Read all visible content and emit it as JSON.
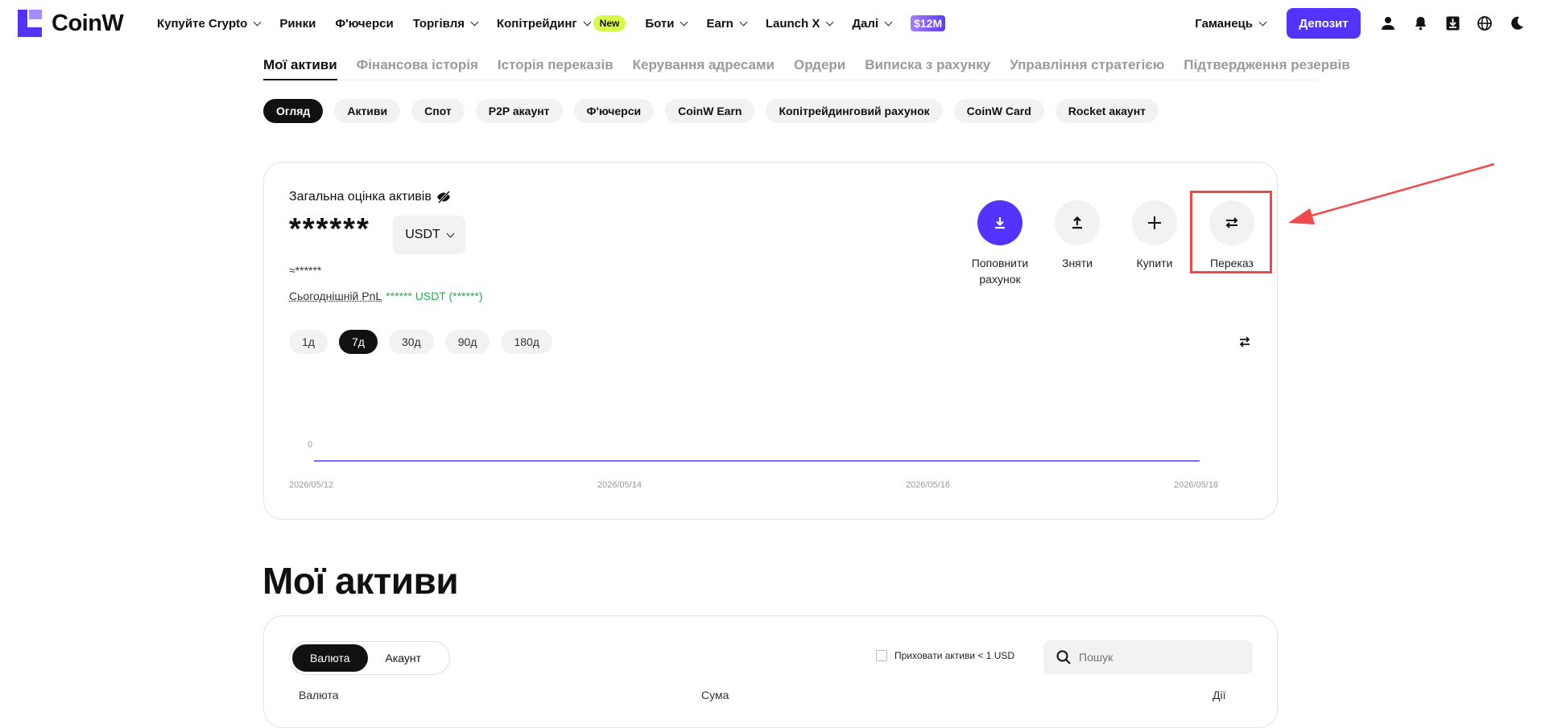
{
  "brand": {
    "name": "CoinW",
    "accent": "#5533ff"
  },
  "nav": {
    "items": [
      {
        "label": "Купуйте Crypto",
        "dropdown": true
      },
      {
        "label": "Ринки",
        "dropdown": false
      },
      {
        "label": "Ф'ючерси",
        "dropdown": false
      },
      {
        "label": "Торгівля",
        "dropdown": true
      },
      {
        "label": "Копітрейдинг",
        "dropdown": true,
        "badge": "New"
      },
      {
        "label": "Боти",
        "dropdown": true
      },
      {
        "label": "Earn",
        "dropdown": true
      },
      {
        "label": "Launch X",
        "dropdown": true
      },
      {
        "label": "Далі",
        "dropdown": true
      }
    ],
    "promo": "$12M"
  },
  "header_right": {
    "wallet": "Гаманець",
    "deposit": "Депозит",
    "icons": [
      "user-icon",
      "bell-icon",
      "download-icon",
      "globe-icon",
      "moon-icon"
    ]
  },
  "tabs": [
    "Мої активи",
    "Фінансова історія",
    "Історія переказів",
    "Керування адресами",
    "Ордери",
    "Виписка з рахунку",
    "Управління стратегією",
    "Підтвердження резервів"
  ],
  "account_pills": [
    "Огляд",
    "Активи",
    "Спот",
    "P2P акаунт",
    "Ф'ючерси",
    "CoinW Earn",
    "Копітрейдинговий рахунок",
    "CoinW Card",
    "Rocket акаунт"
  ],
  "overview": {
    "title": "Загальна оцінка активів",
    "balance_masked": "******",
    "unit": "USDT",
    "approx": "≈******",
    "pnl_label": "Сьогоднішній PnL",
    "pnl_value": "****** USDT (******)",
    "actions": [
      {
        "label": "Поповнити рахунок",
        "icon": "deposit-icon",
        "primary": true
      },
      {
        "label": "Зняти",
        "icon": "withdraw-icon",
        "primary": false
      },
      {
        "label": "Купити",
        "icon": "plus-icon",
        "primary": false
      },
      {
        "label": "Переказ",
        "icon": "transfer-icon",
        "primary": false,
        "highlighted": true
      }
    ],
    "periods": [
      "1д",
      "7д",
      "30д",
      "90д",
      "180д"
    ],
    "active_period": "7д"
  },
  "chart_data": {
    "type": "line",
    "x": [
      "2026/05/12",
      "2026/05/14",
      "2026/05/16",
      "2026/05/18"
    ],
    "y_tick": "0",
    "series": [
      {
        "values": [
          0,
          0,
          0,
          0
        ]
      }
    ],
    "line_color": "#5533ff"
  },
  "assets": {
    "title": "Мої активи",
    "view_toggle": [
      "Валюта",
      "Акаунт"
    ],
    "hide_small": "Приховати активи < 1 USD",
    "search_placeholder": "Пошук",
    "columns": [
      "Валюта",
      "Сума",
      "Дії"
    ]
  }
}
